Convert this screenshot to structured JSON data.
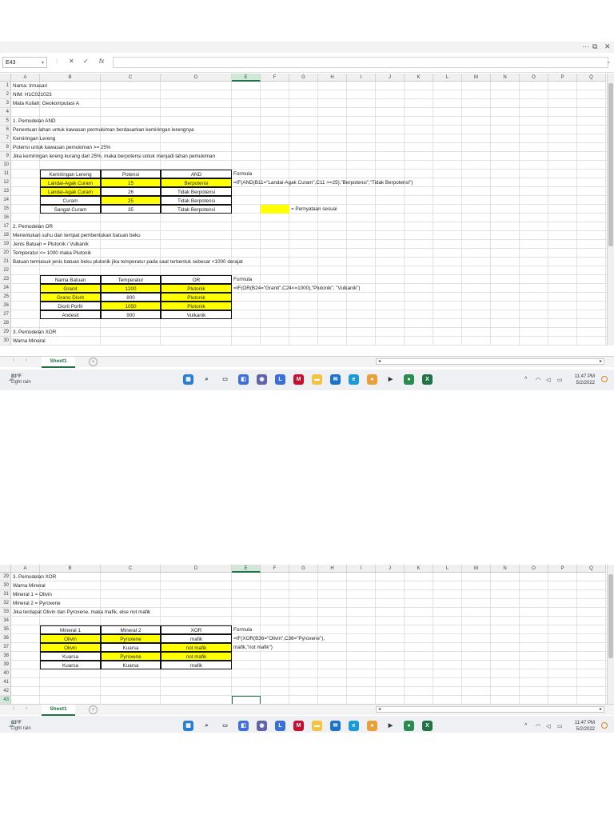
{
  "window": {
    "controls": [
      "···",
      "⧉",
      "✕"
    ]
  },
  "formula_bar": {
    "name_box": "E43",
    "cancel": "✕",
    "enter": "✓",
    "fx": "fx",
    "content": ""
  },
  "columns": [
    "A",
    "B",
    "C",
    "D",
    "E",
    "F",
    "G",
    "H",
    "I",
    "J",
    "K",
    "L",
    "M",
    "N",
    "O",
    "P",
    "Q"
  ],
  "selected_column": "E",
  "shot1": {
    "rows": [
      [
        "1",
        "Nama: Irmasari"
      ],
      [
        "2",
        "NIM: H1C021023"
      ],
      [
        "3",
        "Mata Kuliah: Geokomputasi A"
      ],
      [
        "4",
        ""
      ],
      [
        "5",
        "1. Pemodelan AND"
      ],
      [
        "6",
        "Penentuan lahan untuk kawasan permukiman berdasarkan kemiringan lerengnya"
      ],
      [
        "7",
        "Kemiringan Lereng"
      ],
      [
        "8",
        "Potensi untuk kawasan pemukiman >= 25%"
      ],
      [
        "9",
        "Jika kemiringan lereng kurang dari 25%, maka berpotensi untuk menjadi lahan pemukiman"
      ],
      [
        "10",
        ""
      ],
      [
        "11",
        "",
        "Kemiringan Lereng",
        "Potensi",
        "AND",
        "Formula"
      ],
      [
        "12",
        "",
        "Landai-Agak Curam",
        "15",
        "Berpotensi",
        "=IF(AND(B11=\"Landai-Agak Curam\",C11 >=25),\"Berpotensi\",\"Tidak Berpotensi\")"
      ],
      [
        "13",
        "",
        "Landai-Agak Curam",
        "26",
        "Tidak Berpotensi"
      ],
      [
        "14",
        "",
        "Curam",
        "25",
        "Tidak Berpotensi"
      ],
      [
        "15",
        "",
        "Sangat Curam",
        "35",
        "Tidak Berpotensi",
        "",
        "",
        "= Pernyataan sesuai"
      ],
      [
        "16",
        ""
      ],
      [
        "17",
        "2. Pemodelan OR"
      ],
      [
        "18",
        "Menentukan suhu dan tempat pembentukan batuan beku"
      ],
      [
        "19",
        "Jenis Batuan = Plutonik / Vulkanik"
      ],
      [
        "20",
        "Temperatur <= 1000 maka Plutonik"
      ],
      [
        "21",
        "Batuan termasuk jenis batuan beku plutonik jika temperatur pada saat terbentuk sebesar <1000 derajat"
      ],
      [
        "22",
        ""
      ],
      [
        "23",
        "",
        "Nama Batuan",
        "Temperatur",
        "OR",
        "Formula"
      ],
      [
        "24",
        "",
        "Granit",
        "1200",
        "Plutonik",
        "=IF(OR(B24=\"Granit\",C24<=1000),\"Plutonik\", \"Vulkanik\")"
      ],
      [
        "25",
        "",
        "Grano Diorit",
        "800",
        "Plutonik"
      ],
      [
        "26",
        "",
        "Diorit Porfir",
        "1050",
        "Plutonik"
      ],
      [
        "27",
        "",
        "Andesit",
        "900",
        "Vulkanik"
      ],
      [
        "28",
        ""
      ],
      [
        "29",
        "3. Pemodelan XOR"
      ],
      [
        "30",
        "Warna Mineral"
      ]
    ]
  },
  "shot2": {
    "rows": [
      [
        "29",
        "3. Pemodelan XOR"
      ],
      [
        "30",
        "Warna Mineral"
      ],
      [
        "31",
        "Mineral 1 = Olivin"
      ],
      [
        "32",
        "Mineral 2 = Pyroxene"
      ],
      [
        "33",
        "Jika terdapat Olivin dan Pyroxene, maka mafik, else not mafik"
      ],
      [
        "34",
        ""
      ],
      [
        "35",
        "",
        "Mineral 1",
        "Mineral 2",
        "XOR",
        "Formula"
      ],
      [
        "36",
        "",
        "Olivin",
        "Pyroxene",
        "mafik",
        "=IF(XOR(B36=\"Olivin\",C36=\"Pyroxene\"),"
      ],
      [
        "37",
        "",
        "Olivin",
        "Kuarsa",
        "not mafik",
        "mafik,\"not mafik\")"
      ],
      [
        "38",
        "",
        "Kuarsa",
        "Pyroxene",
        "not mafik"
      ],
      [
        "39",
        "",
        "Kuarsa",
        "Kuarsa",
        "mafik"
      ],
      [
        "40",
        ""
      ],
      [
        "41",
        ""
      ],
      [
        "42",
        ""
      ],
      [
        "43",
        ""
      ]
    ]
  },
  "sheet_tab": "Sheet1",
  "add_sheet": "+",
  "taskbar": {
    "weather_temp": "83°F",
    "weather_desc": "Light rain",
    "time": "11:47 PM",
    "date": "5/2/2022",
    "tray_chevron": "^",
    "icons": [
      "windows-start",
      "search",
      "task-view",
      "widgets",
      "teams-chat",
      "app-l",
      "mcafee",
      "file-explorer",
      "mail",
      "edge",
      "chrome-canary",
      "media",
      "chrome",
      "excel"
    ]
  },
  "colors": {
    "accent": "#217346",
    "highlight": "#ffff00"
  }
}
